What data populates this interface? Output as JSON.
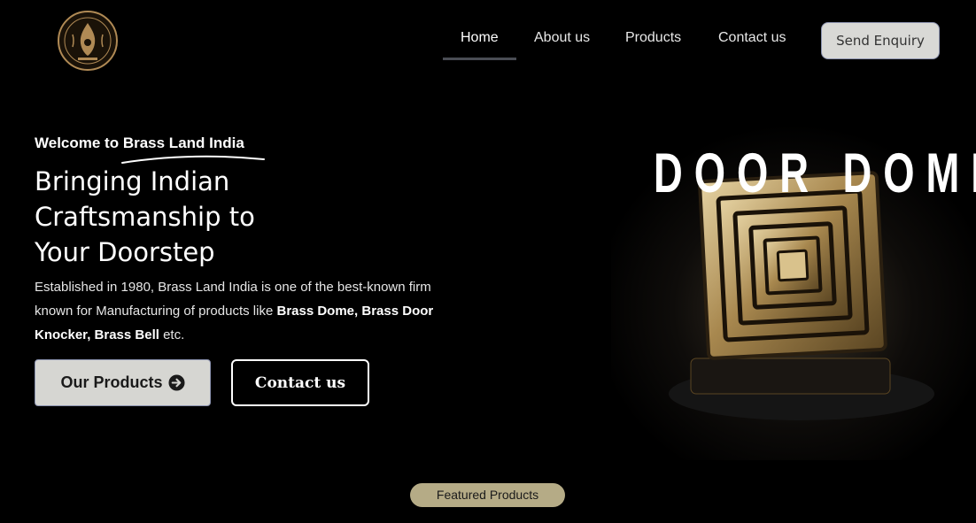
{
  "brand": {
    "logo_icon": "brass-land-logo-icon",
    "logo_color": "#b08a55"
  },
  "nav": {
    "items": [
      {
        "label": "Home",
        "active": true
      },
      {
        "label": "About us",
        "active": false
      },
      {
        "label": "Products",
        "active": false
      },
      {
        "label": "Contact us",
        "active": false
      }
    ],
    "enquiry_label": "Send Enquiry"
  },
  "hero": {
    "welcome_prefix": "Welcome to ",
    "welcome_brand": "Brass Land India",
    "headline_lines": [
      "Bringing Indian",
      "Craftsmanship to",
      "Your Doorstep"
    ],
    "description": {
      "part1": "Established in 1980, Brass Land India is one of the best-known firm known for Manufacturing of products like ",
      "bold1": "Brass Dome,",
      "part2": " ",
      "bold2": "Brass Door Knocker, Brass Bell",
      "part3": " etc."
    },
    "primary_button": "Our Products",
    "primary_icon": "arrow-circle-right-icon",
    "secondary_button": "Contact us",
    "product_title": "DOOR DOME"
  },
  "featured_label": "Featured Products",
  "colors": {
    "background": "#000000",
    "button_light": "#d6d6d2",
    "pill": "#b5ab86",
    "brass": "#b08a55"
  }
}
